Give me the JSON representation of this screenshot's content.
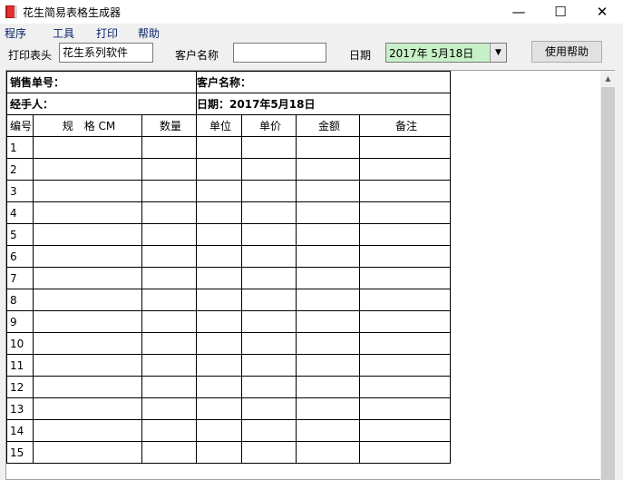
{
  "window": {
    "title": "花生简易表格生成器",
    "minimize": "—",
    "maximize": "☐",
    "close": "✕"
  },
  "menu": [
    "程序",
    "工具",
    "打印",
    "帮助"
  ],
  "toolbar": {
    "print_header_label": "打印表头",
    "print_header_value": "花生系列软件",
    "customer_label": "客户名称",
    "customer_value": "",
    "date_label": "日期",
    "date_value": "2017年 5月18日",
    "help_button": "使用帮助"
  },
  "sheet": {
    "sales_no_label": "销售单号：",
    "customer_label": "客户名称：",
    "handler_label": "经手人：",
    "date_text": "日期：2017年5月18日",
    "columns": [
      "编号",
      "规　格 CM",
      "数量",
      "单位",
      "单价",
      "金额",
      "备注"
    ],
    "rows": [
      "1",
      "2",
      "3",
      "4",
      "5",
      "6",
      "7",
      "8",
      "9",
      "10",
      "11",
      "12",
      "13",
      "14",
      "15"
    ]
  },
  "colors": {
    "date_bg": "#c8f0c8",
    "menu_text": "#0a246a"
  }
}
